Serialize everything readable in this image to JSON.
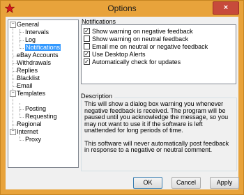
{
  "window": {
    "title": "Options",
    "close_glyph": "×"
  },
  "tree": {
    "items": [
      {
        "label": "General",
        "level": 0,
        "expander": "−"
      },
      {
        "label": "Intervals",
        "level": 1
      },
      {
        "label": "Log",
        "level": 1
      },
      {
        "label": "Notifications",
        "level": 1,
        "selected": true
      },
      {
        "label": "eBay Accounts",
        "level": 0
      },
      {
        "label": "Withdrawals",
        "level": 0
      },
      {
        "label": "Replies",
        "level": 0
      },
      {
        "label": "Blacklist",
        "level": 0
      },
      {
        "label": "Email",
        "level": 0
      },
      {
        "label": "Templates",
        "level": 0,
        "expander": "−"
      },
      {
        "label": "Posting",
        "level": 1
      },
      {
        "label": "Requesting",
        "level": 1
      },
      {
        "label": "Regional",
        "level": 0
      },
      {
        "label": "Internet",
        "level": 0,
        "expander": "−"
      },
      {
        "label": "Proxy",
        "level": 1
      }
    ]
  },
  "notifications": {
    "title": "Notifications",
    "options": [
      {
        "label": "Show warning on negative feedback",
        "checked": true
      },
      {
        "label": "Show warning on neutral feedback",
        "checked": false
      },
      {
        "label": "Email me on neutral or negative feedback",
        "checked": false
      },
      {
        "label": "Use Desktop Alerts",
        "checked": true
      },
      {
        "label": "Automatically check for updates",
        "checked": true
      }
    ]
  },
  "description": {
    "title": "Description",
    "p1": "This will show a dialog box warning you whenever negative feedback is received.  The program will be paused until you acknowledge the message, so you may not want to use it if the software is left unattended for long periods of time.",
    "p2": "This software will never automatically post feedback in response to a negative or neutral comment."
  },
  "buttons": {
    "ok": "OK",
    "cancel": "Cancel",
    "apply": "Apply"
  },
  "colors": {
    "frame": "#e8a33b",
    "selection": "#3399ff",
    "close": "#c74a3b"
  }
}
